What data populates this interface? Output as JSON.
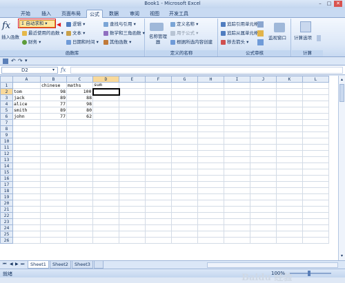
{
  "window": {
    "title": "Book1 - Microsoft Excel"
  },
  "tabs": [
    "开始",
    "插入",
    "页面布局",
    "公式",
    "数据",
    "审阅",
    "视图",
    "开发工具"
  ],
  "active_tab": "公式",
  "ribbon": {
    "function_library": {
      "insert_function": "插入函数",
      "autosum": "自动求和",
      "recent": "最近使用的函数",
      "financial": "财务",
      "logical": "逻辑",
      "text": "文本",
      "datetime": "日期和时间",
      "lookup": "查找与引用",
      "math": "数学和三角函数",
      "other": "其他函数",
      "label": "函数库"
    },
    "defined_names": {
      "name_manager": "名称管理器",
      "define_name": "定义名称",
      "use_in_formula": "用于公式",
      "create_from_selection": "根据所选内容创建",
      "label": "定义的名称"
    },
    "formula_auditing": {
      "trace_precedents": "追踪引用单元格",
      "trace_dependents": "追踪从属单元格",
      "remove_arrows": "移去箭头",
      "watch_window": "监视窗口",
      "label": "公式审核"
    },
    "calculation": {
      "options": "计算选项",
      "label": "计算"
    }
  },
  "formula_bar": {
    "name_box": "D2",
    "fx": "fx",
    "formula": ""
  },
  "columns": [
    "A",
    "B",
    "C",
    "D",
    "E",
    "F",
    "G",
    "H",
    "I",
    "J",
    "K",
    "L"
  ],
  "selected_column": "D",
  "selected_row": 2,
  "rows": [
    [
      "",
      "chinese",
      "maths",
      "sum"
    ],
    [
      "tom",
      "98",
      "100",
      ""
    ],
    [
      "jack",
      "89",
      "88",
      ""
    ],
    [
      "alice",
      "77",
      "98",
      ""
    ],
    [
      "smith",
      "89",
      "80",
      ""
    ],
    [
      "john",
      "77",
      "62",
      ""
    ]
  ],
  "total_rows": 26,
  "sheets": [
    "Sheet1",
    "Sheet2",
    "Sheet3"
  ],
  "active_sheet": "Sheet1",
  "status": {
    "ready": "就绪",
    "zoom": "100%"
  },
  "watermark": "Baidu 经验",
  "colors": {
    "ribbon": "#dbe7f7",
    "highlight": "#fde8a0",
    "callout": "#e0191f"
  }
}
